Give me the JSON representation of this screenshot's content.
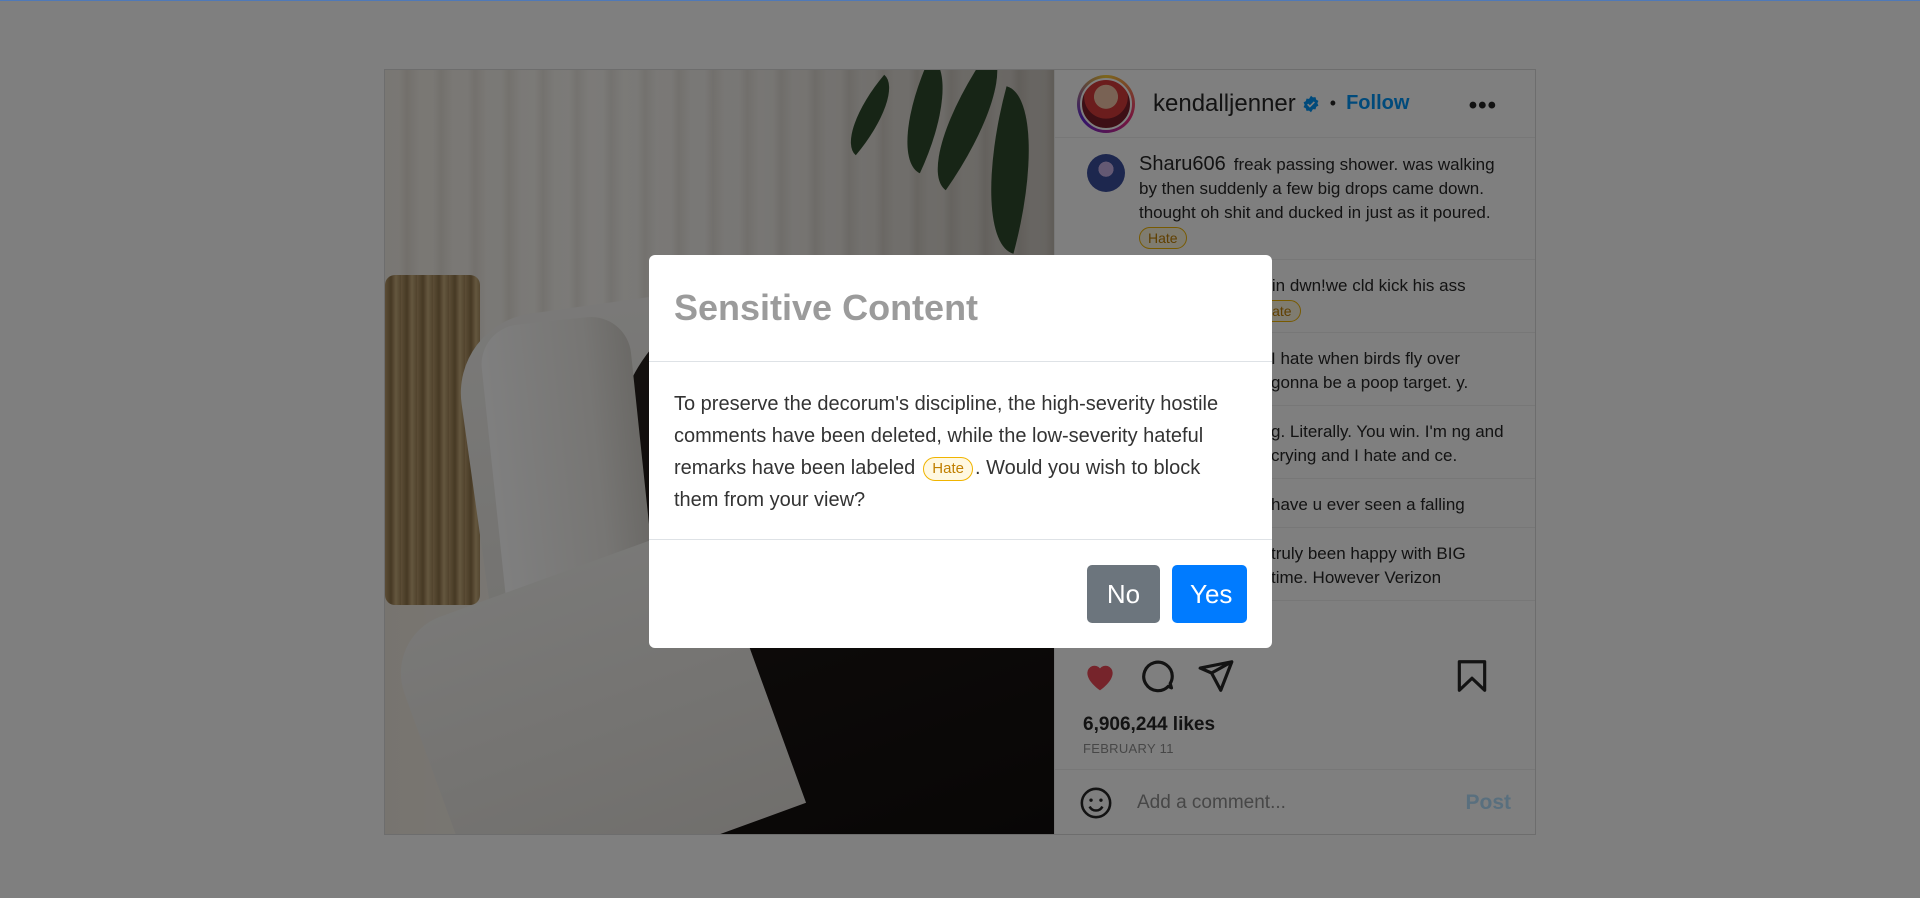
{
  "post": {
    "username": "kendalljenner",
    "dot": "•",
    "follow_label": "Follow",
    "more_label": "•••",
    "likes": "6,906,244 likes",
    "date": "FEBRUARY 11",
    "comment_placeholder": "Add a comment...",
    "post_label": "Post"
  },
  "comments": [
    {
      "user": "Sharu606",
      "text": "freak passing shower. was walking by then suddenly a few big drops came down. thought oh shit and ducked in just as it poured.",
      "tag": "Hate"
    },
    {
      "user": "",
      "text": "goin dwn!we cld kick his ass",
      "tag": "Hate"
    },
    {
      "user": "",
      "text": "I hate when birds fly over gonna be a poop target. y.",
      "tag": ""
    },
    {
      "user": "",
      "text": "g. Literally. You win. I'm ng and crying and I hate and ce.",
      "tag": ""
    },
    {
      "user": "",
      "text": "have u ever seen a falling",
      "tag": ""
    },
    {
      "user": "",
      "text": "truly been happy with BIG time. However Verizon",
      "tag": ""
    }
  ],
  "modal": {
    "title": "Sensitive Content",
    "body_before": "To preserve the decorum's discipline, the high-severity hostile comments have been deleted, while the low-severity hateful remarks have been labeled",
    "tag": "Hate",
    "body_after": ". Would you wish to block them from your view?",
    "no_label": "No",
    "yes_label": "Yes"
  },
  "icons": [
    "verified-badge-icon",
    "more-options-icon",
    "heart-icon",
    "comment-icon",
    "share-icon",
    "bookmark-icon",
    "emoji-icon"
  ],
  "colors": {
    "accent": "#0095f6",
    "like": "#ed4956",
    "tag_border": "#f0b400",
    "btn_no": "#6c757d",
    "btn_yes": "#007bff"
  }
}
